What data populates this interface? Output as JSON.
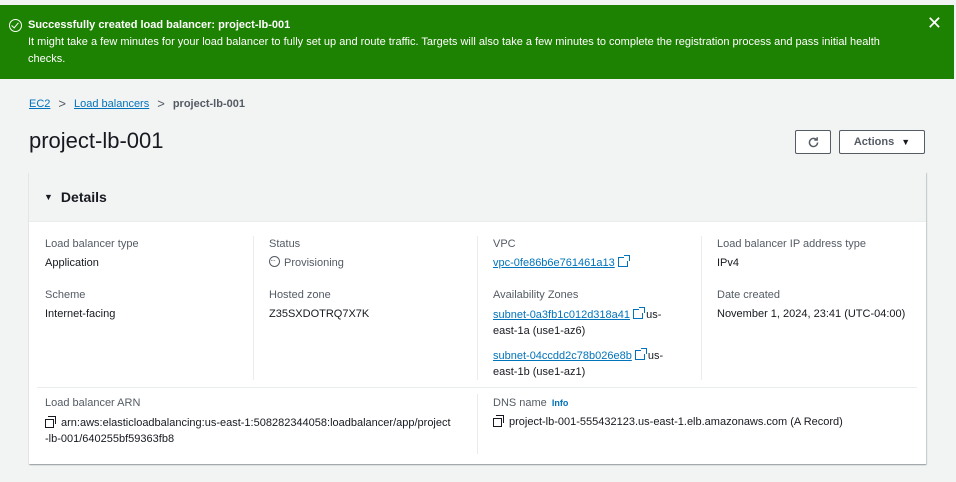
{
  "flash": {
    "title_prefix": "Successfully created load balancer: ",
    "title_name": "project-lb-001",
    "message": "It might take a few minutes for your load balancer to fully set up and route traffic. Targets will also take a few minutes to complete the registration process and pass initial health checks.",
    "close_glyph": "✕",
    "color": "#1d8102"
  },
  "breadcrumb": {
    "items": [
      "EC2",
      "Load balancers"
    ],
    "current": "project-lb-001",
    "separator": ">"
  },
  "page": {
    "title": "project-lb-001",
    "actions_label": "Actions",
    "actions_caret": "▼"
  },
  "details": {
    "header": "Details",
    "toggle_glyph": "▼",
    "lb_type_label": "Load balancer type",
    "lb_type_value": "Application",
    "status_label": "Status",
    "status_value": "Provisioning",
    "vpc_label": "VPC",
    "vpc_value": "vpc-0fe86b6e761461a13",
    "ip_type_label": "Load balancer IP address type",
    "ip_type_value": "IPv4",
    "scheme_label": "Scheme",
    "scheme_value": "Internet-facing",
    "hosted_zone_label": "Hosted zone",
    "hosted_zone_value": "Z35SXDOTRQ7X7K",
    "az_label": "Availability Zones",
    "az1_link": "subnet-0a3fb1c012d318a41",
    "az1_suffix_a": " us-",
    "az1_suffix_b": "east-1a (use1-az6)",
    "az2_link": "subnet-04ccdd2c78b026e8b",
    "az2_suffix_a": " us-",
    "az2_suffix_b": "east-1b (use1-az1)",
    "date_label": "Date created",
    "date_value": "November 1, 2024, 23:41 (UTC-04:00)",
    "arn_label": "Load balancer ARN",
    "arn_value_line1": "arn:aws:elasticloadbalancing:us-east-1:508282344058:loadbalancer/app/project",
    "arn_value_line2": "-lb-001/640255bf59363fb8",
    "dns_label": "DNS name",
    "dns_info": "Info",
    "dns_value": "project-lb-001-555432123.us-east-1.elb.amazonaws.com (A Record)"
  }
}
